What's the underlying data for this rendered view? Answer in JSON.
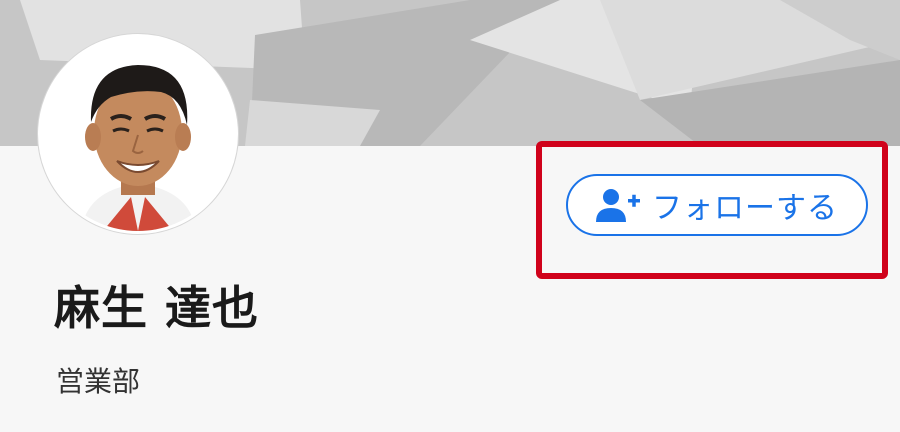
{
  "profile": {
    "name": "麻生 達也",
    "department": "営業部",
    "avatar_icon": "person-photo"
  },
  "follow_button": {
    "label": "フォローする",
    "icon": "add-person-icon"
  },
  "colors": {
    "accent": "#1a73e8",
    "highlight": "#d0021b",
    "cover": "#c8c8c8",
    "background": "#f7f7f7"
  }
}
